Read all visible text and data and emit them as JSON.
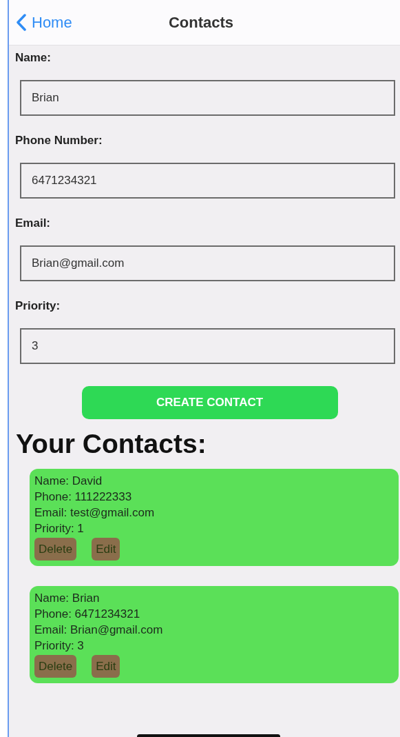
{
  "nav": {
    "back": "Home",
    "title": "Contacts"
  },
  "form": [
    {
      "label": "Name:",
      "value": "Brian"
    },
    {
      "label": "Phone Number:",
      "value": "6471234321"
    },
    {
      "label": "Email:",
      "value": "Brian@gmail.com"
    },
    {
      "label": "Priority:",
      "value": "3"
    }
  ],
  "create_button": "CREATE CONTACT",
  "heading": "Your Contacts:",
  "contacts": [
    {
      "lines": [
        "Name: David",
        "Phone: 111222333",
        "Email: test@gmail.com",
        "Priority: 1"
      ],
      "buttons": [
        "Delete",
        "Edit"
      ]
    },
    {
      "lines": [
        "Name: Brian",
        "Phone: 6471234321",
        "Email: Brian@gmail.com",
        "Priority: 3"
      ],
      "buttons": [
        "Delete",
        "Edit"
      ]
    }
  ]
}
